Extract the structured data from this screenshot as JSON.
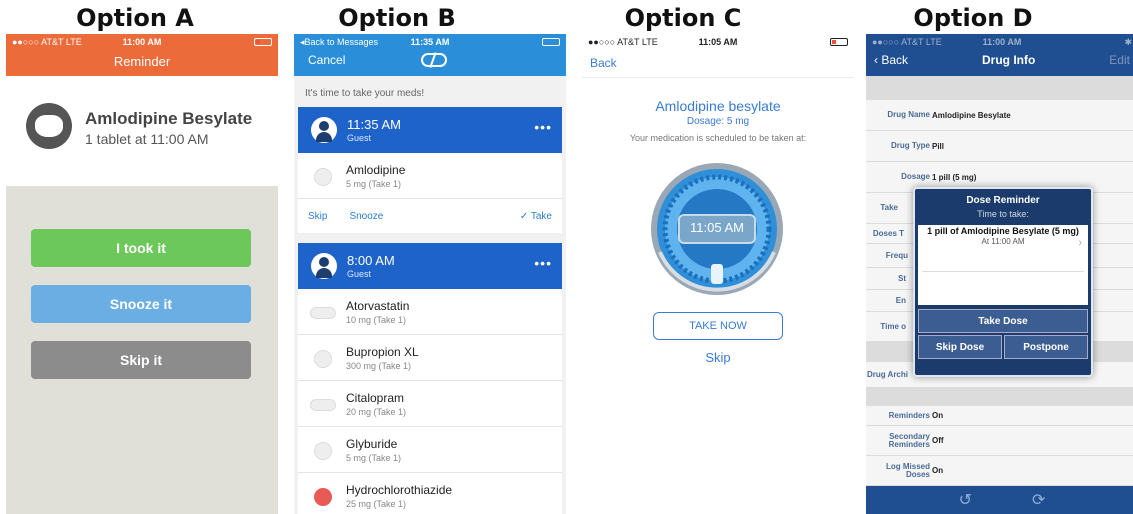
{
  "titles": [
    "Option A",
    "Option B",
    "Option C",
    "Option D"
  ],
  "a": {
    "status": {
      "carrier": "●●○○○ AT&T  LTE",
      "time": "11:00 AM"
    },
    "nav_title": "Reminder",
    "drug_name": "Amlodipine Besylate",
    "drug_sub": "1 tablet at 11:00 AM",
    "buttons": {
      "took": "I took it",
      "snooze": "Snooze it",
      "skip": "Skip it"
    },
    "colors": {
      "header": "#ec6b3a",
      "took": "#6cc85a",
      "snooze": "#6aaee3",
      "skip": "#8c8c8c"
    }
  },
  "b": {
    "status": {
      "back": "◂Back to Messages",
      "time": "11:35 AM"
    },
    "cancel": "Cancel",
    "hint": "It's time to take your meds!",
    "card1": {
      "time": "11:35 AM",
      "user": "Guest",
      "more": "•••"
    },
    "card1_items": [
      {
        "name": "Amlodipine",
        "dose": "5 mg (Take 1)"
      }
    ],
    "actions": {
      "skip": "Skip",
      "snooze": "Snooze",
      "take": "✓ Take"
    },
    "card2": {
      "time": "8:00 AM",
      "user": "Guest",
      "more": "•••"
    },
    "card2_items": [
      {
        "name": "Atorvastatin",
        "dose": "10 mg (Take 1)"
      },
      {
        "name": "Bupropion XL",
        "dose": "300 mg (Take 1)"
      },
      {
        "name": "Citalopram",
        "dose": "20 mg (Take 1)"
      },
      {
        "name": "Glyburide",
        "dose": "5 mg (Take 1)"
      },
      {
        "name": "Hydrochlorothiazide",
        "dose": "25 mg (Take 1)"
      }
    ]
  },
  "c": {
    "status": {
      "carrier": "●●○○○ AT&T  LTE",
      "time": "11:05 AM"
    },
    "back": "Back",
    "drug_name": "Amlodipine besylate",
    "dosage": "Dosage: 5 mg",
    "scheduled": "Your medication is scheduled to be taken at:",
    "clock": "11:05 AM",
    "take_now": "TAKE NOW",
    "skip": "Skip"
  },
  "d": {
    "status": {
      "carrier": "●●○○○ AT&T  LTE",
      "time": "11:00 AM"
    },
    "back": "Back",
    "title": "Drug Info",
    "edit": "Edit",
    "fields": [
      {
        "label": "Drug Name",
        "value": "Amlodipine Besylate"
      },
      {
        "label": "Drug Type",
        "value": "Pill"
      },
      {
        "label": "Dosage",
        "value": "1 pill (5 mg)"
      },
      {
        "label": "Take",
        "value": ""
      },
      {
        "label": "Doses T",
        "value": ""
      },
      {
        "label": "Frequ",
        "value": ""
      },
      {
        "label": "St",
        "value": ""
      },
      {
        "label": "En",
        "value": ""
      },
      {
        "label": "Time o",
        "value": ""
      }
    ],
    "archive_label": "Drug Archi",
    "fields2": [
      {
        "label": "Reminders",
        "value": "On"
      },
      {
        "label": "Secondary Reminders",
        "value": "Off"
      },
      {
        "label": "Log Missed Doses",
        "value": "On"
      }
    ],
    "dialog": {
      "title": "Dose Reminder",
      "subtitle": "Time to take:",
      "med": "1 pill of Amlodipine Besylate (5 mg)",
      "at": "At 11:00 AM",
      "take": "Take Dose",
      "skip": "Skip Dose",
      "postpone": "Postpone"
    },
    "toolbar_icons": [
      "history-icon",
      "refresh-icon"
    ]
  }
}
